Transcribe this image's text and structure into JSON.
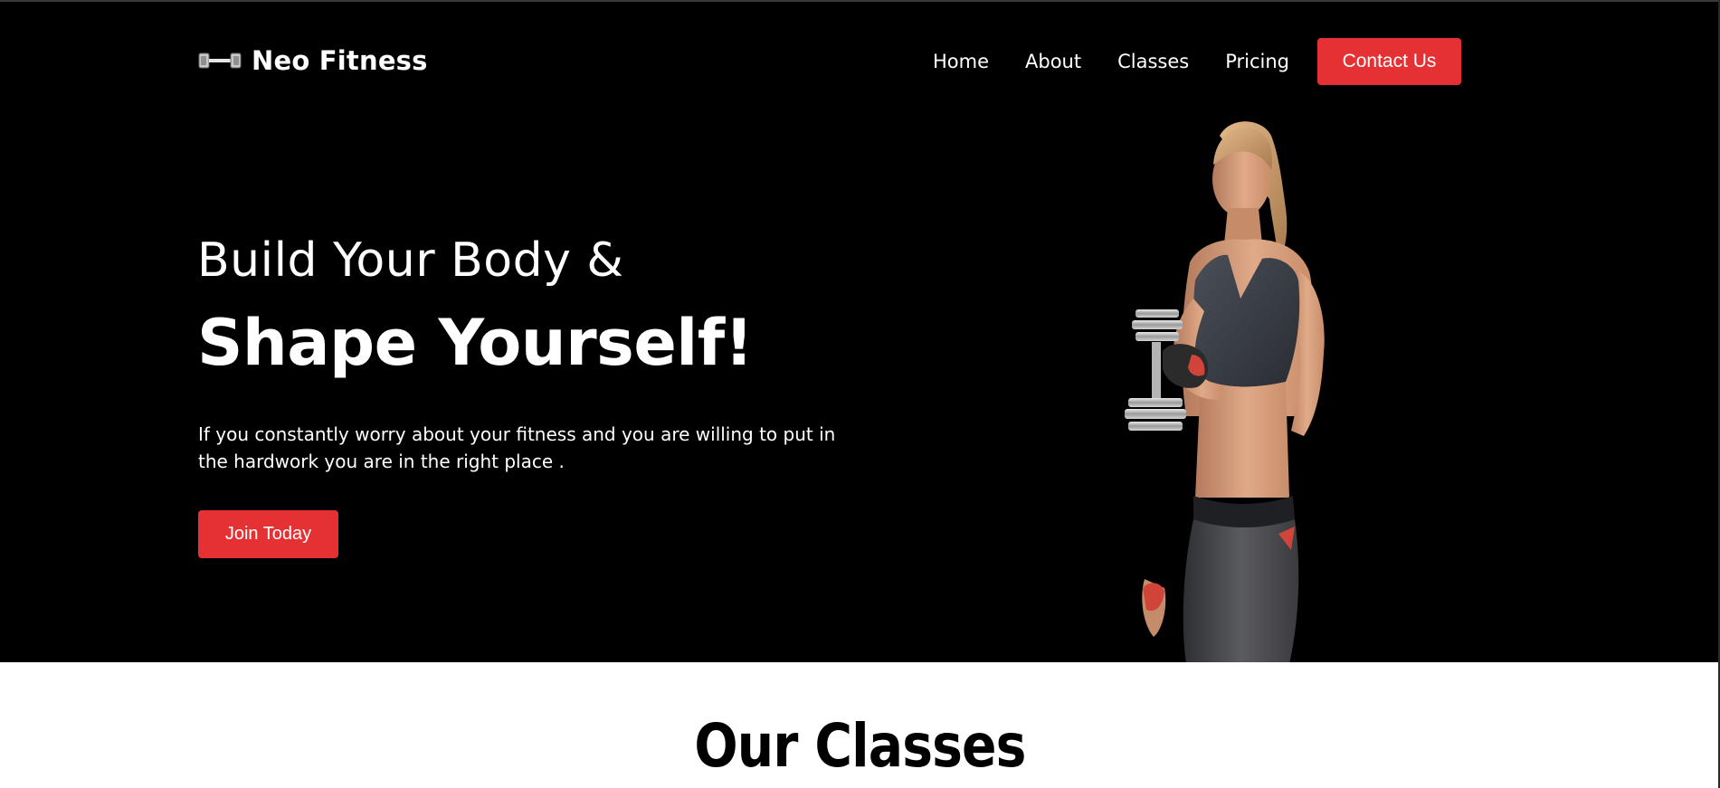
{
  "brand": {
    "name": "Neo Fitness",
    "logo_icon": "dumbbell-icon"
  },
  "nav": {
    "items": [
      {
        "label": "Home"
      },
      {
        "label": "About"
      },
      {
        "label": "Classes"
      },
      {
        "label": "Pricing"
      }
    ],
    "cta_label": "Contact Us"
  },
  "hero": {
    "headline_line1": "Build Your Body &",
    "headline_line2": "Shape Yourself!",
    "tagline": "If you constantly worry about your fitness and you are willing to put in the hardwork you are in the right place .",
    "cta_label": "Join Today",
    "image_subject": "woman-holding-dumbbell"
  },
  "classes_section": {
    "title": "Our Classes"
  },
  "colors": {
    "accent": "#e53133",
    "hero_background": "#000000",
    "text_light": "#ffffff",
    "text_dark": "#000000"
  }
}
